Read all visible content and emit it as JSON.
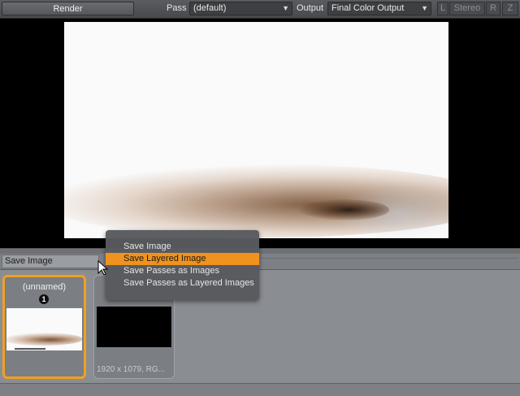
{
  "toolbar": {
    "render_label": "Render",
    "pass_label": "Pass",
    "pass_value": "(default)",
    "output_label": "Output",
    "output_value": "Final Color Output",
    "left_eye": "L",
    "stereo": "Stereo",
    "right_eye": "R",
    "extra": "Z"
  },
  "actionbar": {
    "save_value": "Save Image"
  },
  "menu": {
    "items": [
      {
        "label": "Save Image"
      },
      {
        "label": "Save Layered Image"
      },
      {
        "label": "Save Passes as Images"
      },
      {
        "label": "Save Passes as Layered Images"
      }
    ],
    "highlighted_index": 1
  },
  "gallery": {
    "items": [
      {
        "title": "(unnamed)",
        "badge": "1",
        "selected": true
      },
      {
        "title": "",
        "info": "1920 x 1079, RG..."
      }
    ]
  },
  "colors": {
    "accent": "#f0921e",
    "selection_border": "#f0a020"
  }
}
